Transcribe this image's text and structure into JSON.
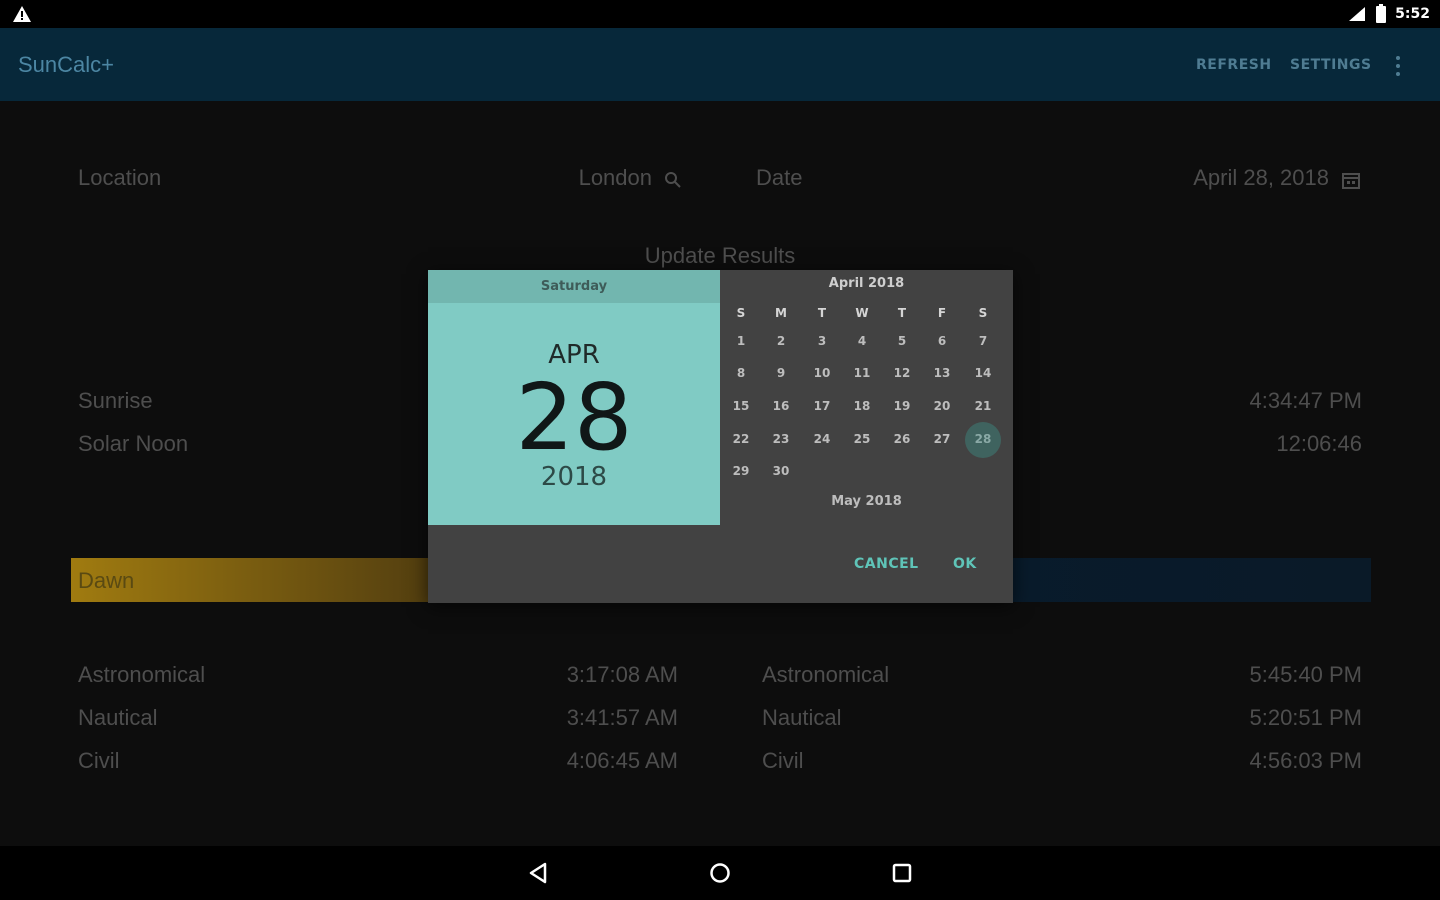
{
  "status_bar": {
    "time": "5:52",
    "icons": [
      "warning-icon",
      "signal-icon",
      "battery-icon"
    ]
  },
  "app_bar": {
    "title": "SunCalc+",
    "refresh_label": "REFRESH",
    "settings_label": "SETTINGS"
  },
  "form": {
    "location_label": "Location",
    "location_value": "London",
    "date_label": "Date",
    "date_value": "April 28, 2018",
    "update_label": "Update Results"
  },
  "results": {
    "sunrise_label": "Sunrise",
    "sunset_value": "4:34:47 PM",
    "noon_label": "Solar Noon",
    "noon_value": "12:06:46"
  },
  "dawn": {
    "label": "Dawn"
  },
  "twilight": {
    "left": [
      {
        "label": "Astronomical",
        "value": "3:17:08 AM"
      },
      {
        "label": "Nautical",
        "value": "3:41:57 AM"
      },
      {
        "label": "Civil",
        "value": "4:06:45 AM"
      }
    ],
    "right": [
      {
        "label": "Astronomical",
        "value": "5:45:40 PM"
      },
      {
        "label": "Nautical",
        "value": "5:20:51 PM"
      },
      {
        "label": "Civil",
        "value": "4:56:03 PM"
      }
    ]
  },
  "date_picker": {
    "day_of_week": "Saturday",
    "month": "APR",
    "day": "28",
    "year": "2018",
    "calendar_title": "April 2018",
    "next_month": "May 2018",
    "weekdays": [
      "S",
      "M",
      "T",
      "W",
      "T",
      "F",
      "S"
    ],
    "weeks": [
      [
        "1",
        "2",
        "3",
        "4",
        "5",
        "6",
        "7"
      ],
      [
        "8",
        "9",
        "10",
        "11",
        "12",
        "13",
        "14"
      ],
      [
        "15",
        "16",
        "17",
        "18",
        "19",
        "20",
        "21"
      ],
      [
        "22",
        "23",
        "24",
        "25",
        "26",
        "27",
        "28"
      ],
      [
        "29",
        "30"
      ]
    ],
    "selected_day": "28",
    "cancel_label": "CANCEL",
    "ok_label": "OK",
    "accent": "#80cbc4"
  }
}
